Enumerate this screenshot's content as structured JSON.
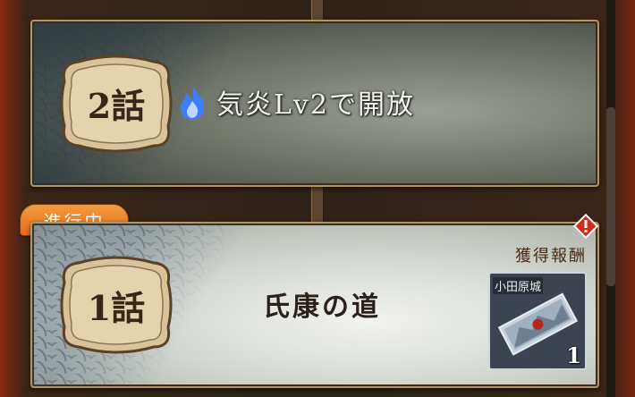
{
  "chapters": [
    {
      "number_label": "2話",
      "lock_text": "気炎Lv2で開放",
      "lock_icon": "blue-flame-icon",
      "status": "locked"
    },
    {
      "number_label": "1話",
      "title": "氏康の道",
      "status": "in-progress"
    }
  ],
  "progress_badge": "進行中",
  "reward": {
    "label": "獲得報酬",
    "item_name": "小田原城",
    "item_icon": "castle-ticket-icon",
    "count": "1"
  },
  "colors": {
    "badge_orange": "#e56d1e",
    "frame_gold": "#b39560",
    "flame_blue": "#3f7dff",
    "alert_red": "#d2281e"
  }
}
